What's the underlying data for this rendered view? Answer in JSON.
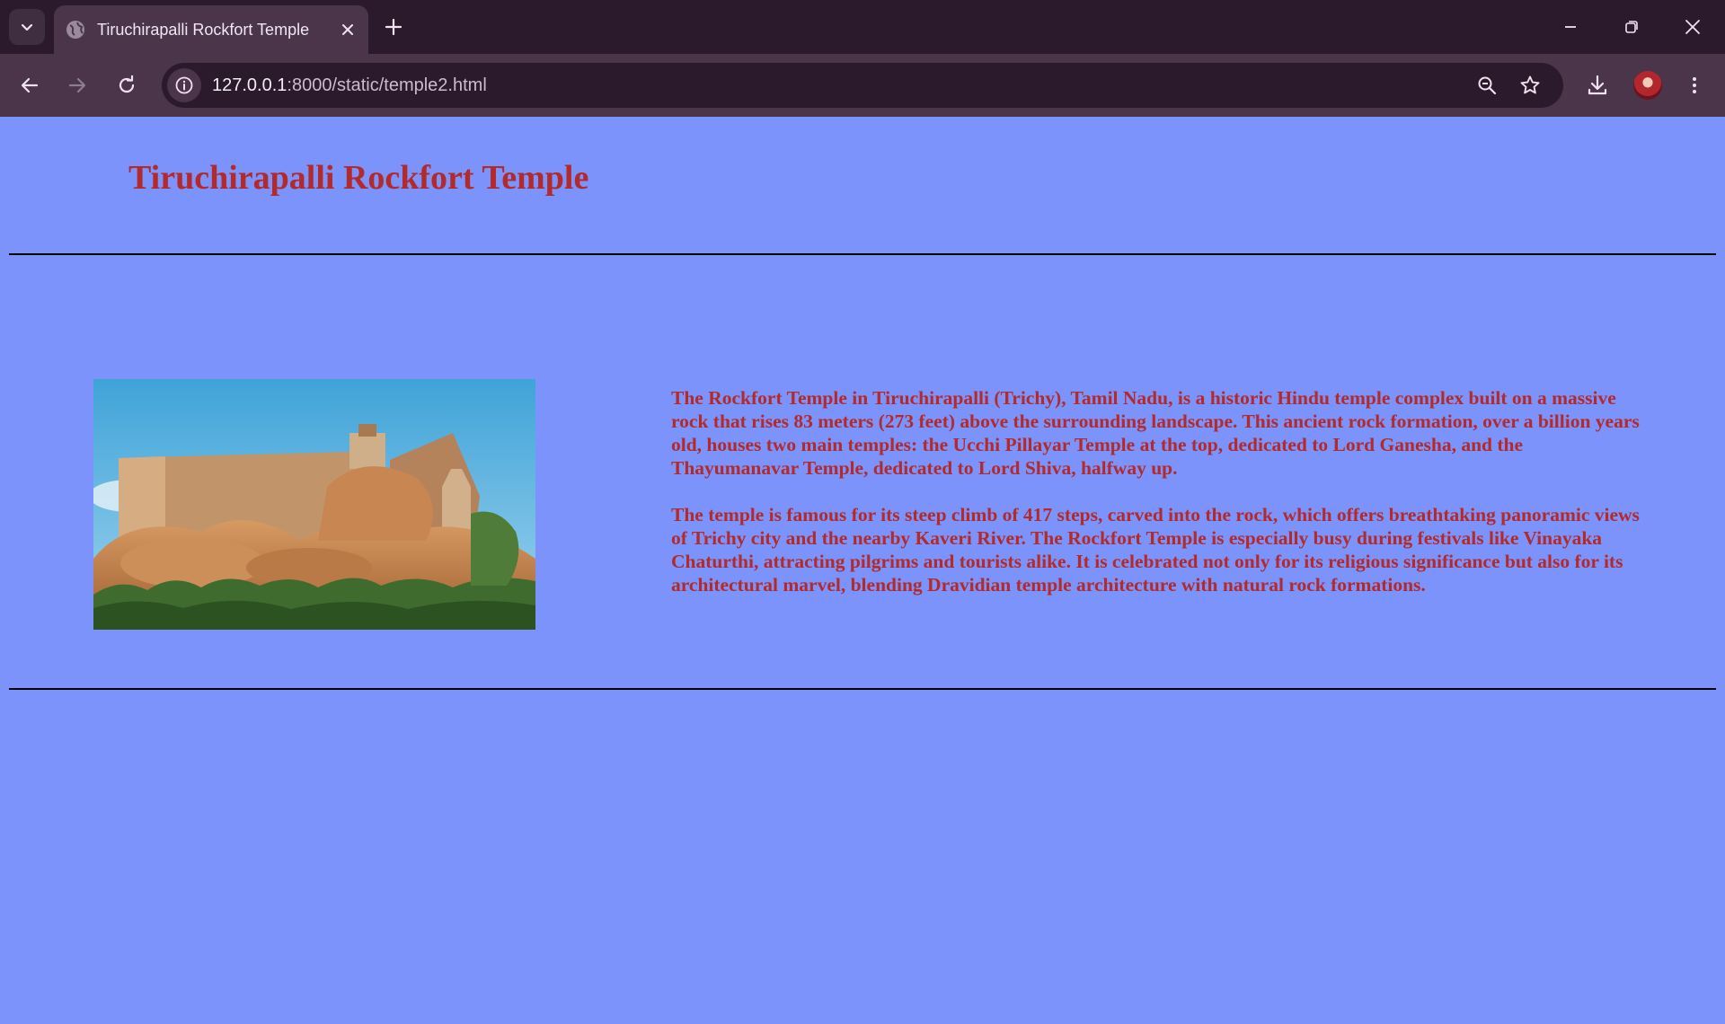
{
  "browser": {
    "tab": {
      "title": "Tiruchirapalli Rockfort Temple"
    },
    "address": {
      "host": "127.0.0.1",
      "path": ":8000/static/temple2.html"
    },
    "icons": {
      "tab_search": "chevron-down-icon",
      "favicon": "globe-icon",
      "close_tab": "close-icon",
      "new_tab": "plus-icon",
      "back": "arrow-left-icon",
      "forward": "arrow-right-icon",
      "reload": "reload-icon",
      "site_info": "info-icon",
      "zoom": "zoom-icon",
      "bookmark": "star-icon",
      "downloads": "download-icon",
      "menu": "kebab-icon"
    }
  },
  "page": {
    "background": "#7b93fb",
    "text_color": "#b22a2a",
    "title": "Tiruchirapalli Rockfort Temple",
    "paragraphs": [
      "The Rockfort Temple in Tiruchirapalli (Trichy), Tamil Nadu, is a historic Hindu temple complex built on a massive rock that rises 83 meters (273 feet) above the surrounding landscape. This ancient rock formation, over a billion years old, houses two main temples: the Ucchi Pillayar Temple at the top, dedicated to Lord Ganesha, and the Thayumanavar Temple, dedicated to Lord Shiva, halfway up.",
      "The temple is famous for its steep climb of 417 steps, carved into the rock, which offers breathtaking panoramic views of Trichy city and the nearby Kaveri River. The Rockfort Temple is especially busy during festivals like Vinayaka Chaturthi, attracting pilgrims and tourists alike. It is celebrated not only for its religious significance but also for its architectural marvel, blending Dravidian temple architecture with natural rock formations."
    ]
  }
}
